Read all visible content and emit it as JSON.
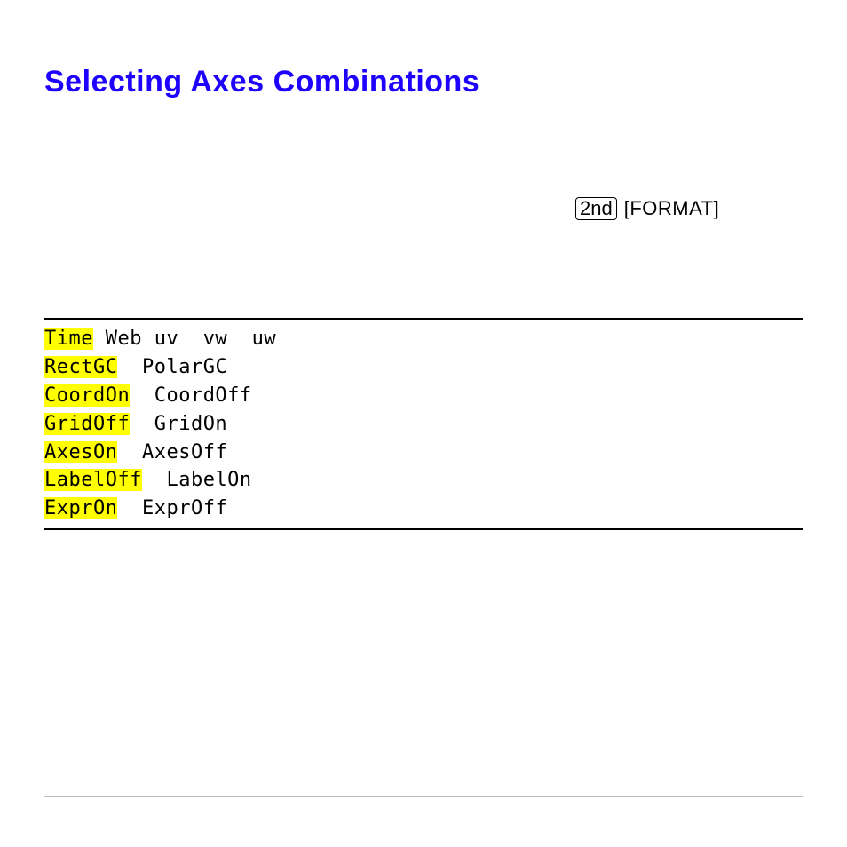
{
  "title": "Selecting Axes Combinations",
  "keys": {
    "second": "2nd",
    "format": "[FORMAT]"
  },
  "screen": {
    "r0": {
      "a": "Time",
      "b": " Web uv  vw  uw"
    },
    "r1": {
      "a": "RectGC",
      "b": "  PolarGC"
    },
    "r2": {
      "a": "CoordOn",
      "b": "  CoordOff"
    },
    "r3": {
      "a": "GridOff",
      "b": "  GridOn"
    },
    "r4": {
      "a": "AxesOn",
      "b": "  AxesOff"
    },
    "r5": {
      "a": "LabelOff",
      "b": "  LabelOn"
    },
    "r6": {
      "a": "ExprOn",
      "b": "  ExprOff"
    }
  }
}
